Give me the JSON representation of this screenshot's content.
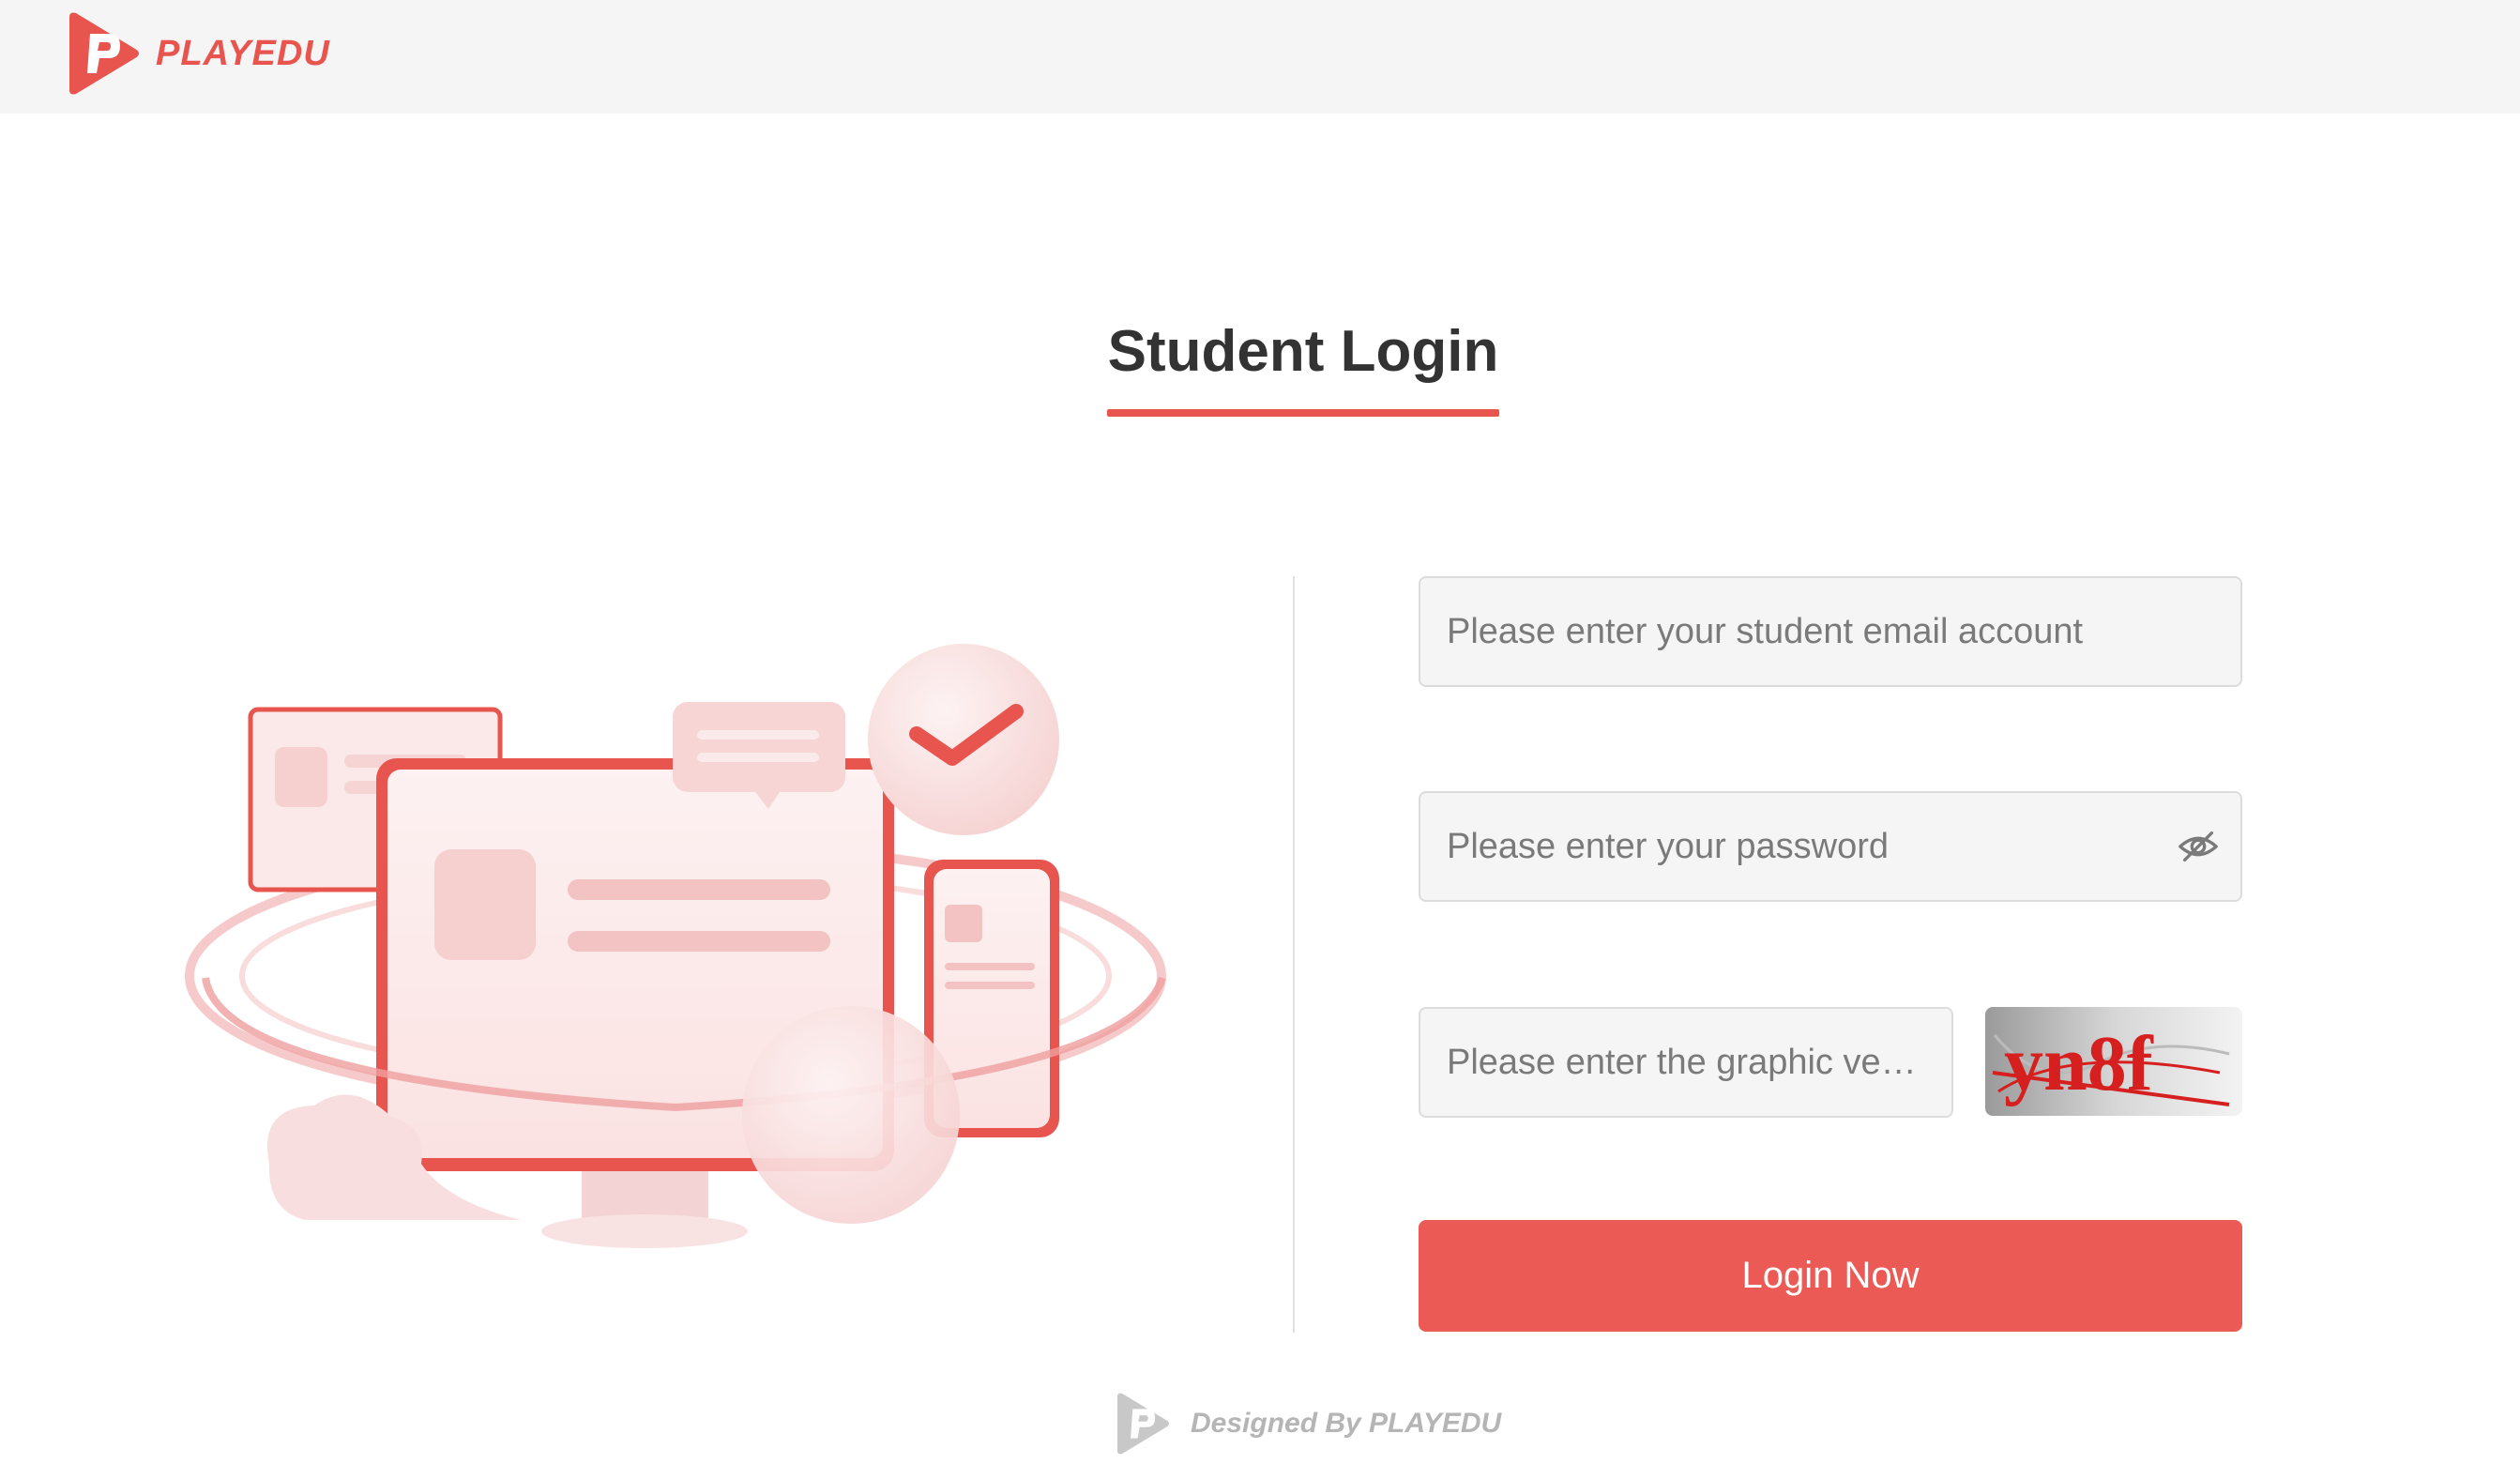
{
  "header": {
    "brand_name": "PLAYEDU",
    "logo_icon": "playedu-logo-icon",
    "brand_color": "#e8544e"
  },
  "login": {
    "title": "Student Login",
    "email_placeholder": "Please enter your student email account",
    "password_placeholder": "Please enter your password",
    "password_toggle_icon": "eye-slash-icon",
    "captcha_placeholder": "Please enter the graphic verification code",
    "captcha_text": "yn8f",
    "submit_label": "Login Now",
    "button_color": "#ec5a55"
  },
  "footer": {
    "text": "Designed By PLAYEDU"
  }
}
